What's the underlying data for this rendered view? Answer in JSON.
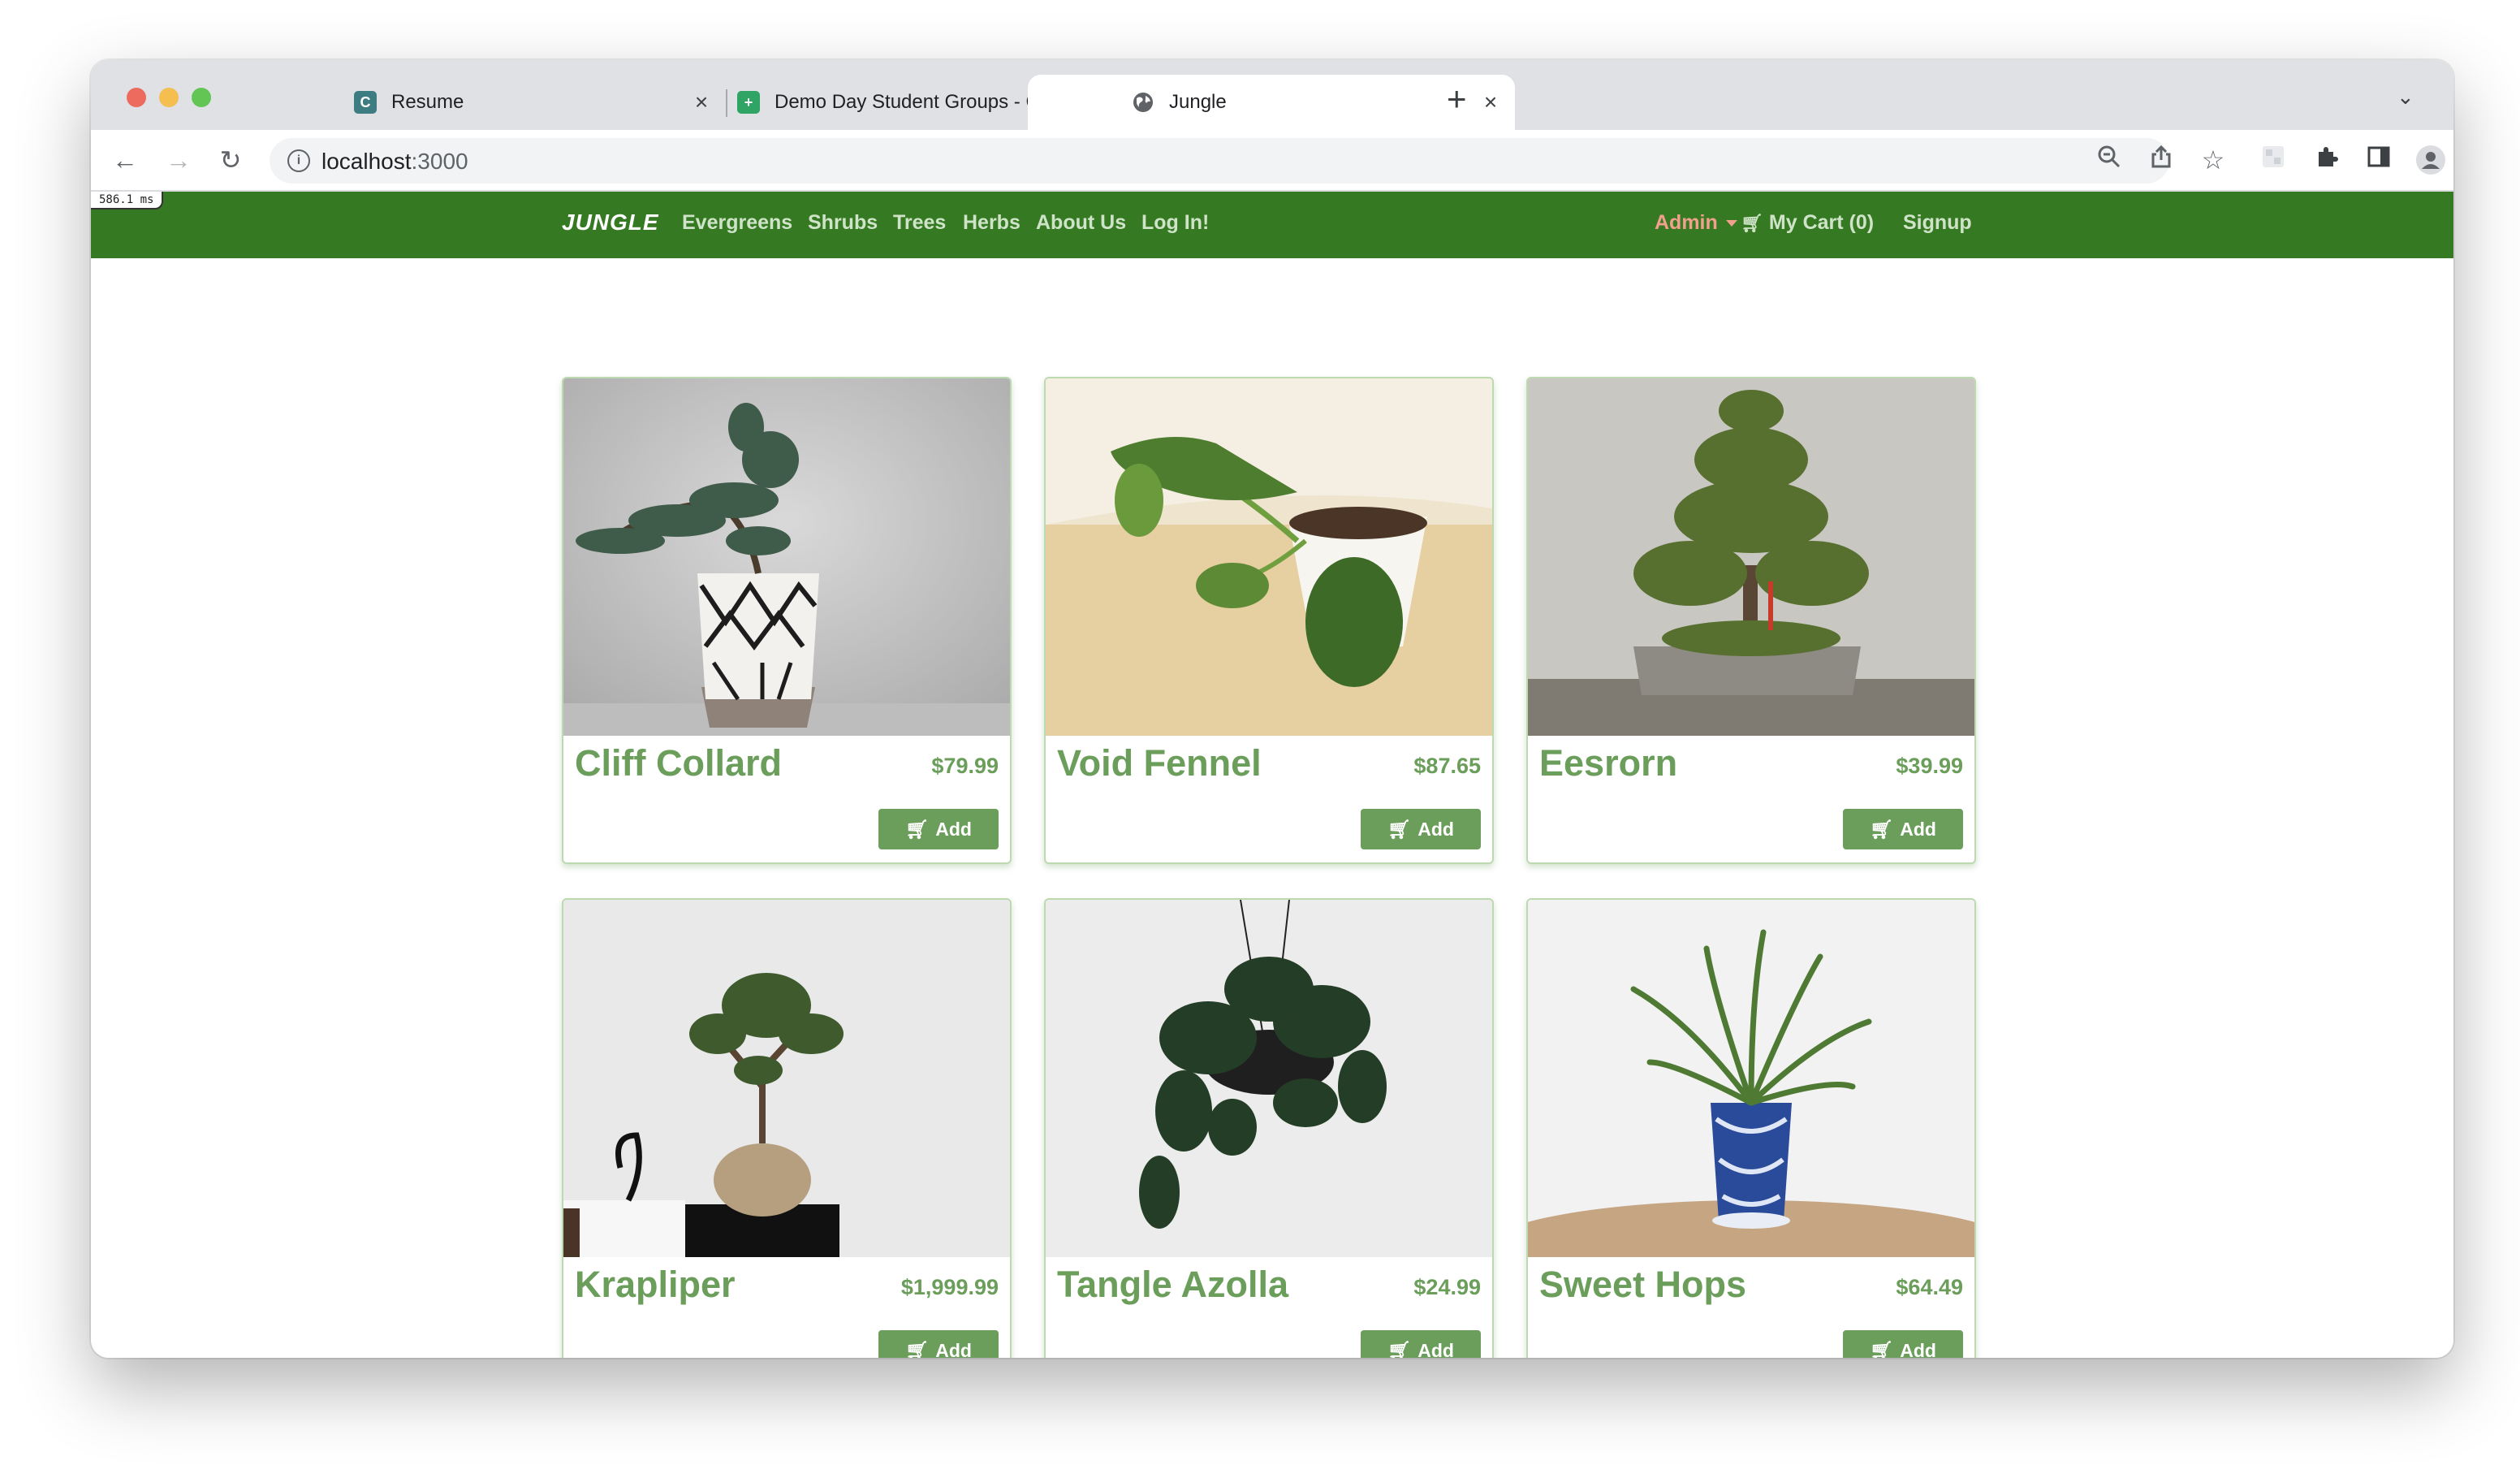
{
  "browser": {
    "tabs": [
      {
        "title": "Resume",
        "favicon": "C",
        "favicon_color": "#3d7d82"
      },
      {
        "title": "Demo Day Student Groups - G",
        "favicon": "+",
        "favicon_color": "#2fa464"
      },
      {
        "title": "Jungle",
        "favicon": "globe-icon",
        "active": true
      }
    ],
    "new_tab": "+",
    "url": {
      "host": "localhost",
      "port": ":3000"
    }
  },
  "timing_badge": "586.1 ms",
  "nav": {
    "brand": "JUNGLE",
    "links": [
      "Evergreens",
      "Shrubs",
      "Trees",
      "Herbs",
      "About Us",
      "Log In!"
    ],
    "admin": "Admin",
    "cart": "My Cart (0)",
    "signup": "Signup",
    "bar_color": "#357a22"
  },
  "products": [
    {
      "name": "Cliff Collard",
      "price": "$79.99",
      "add_label": "Add",
      "image": "juniper-bonsai-in-patterned-pot"
    },
    {
      "name": "Void Fennel",
      "price": "$87.65",
      "add_label": "Add",
      "image": "pothos-cutting-in-white-cup"
    },
    {
      "name": "Eesrorn",
      "price": "$39.99",
      "add_label": "Add",
      "image": "bonsai-tree-in-tray"
    },
    {
      "name": "Krapliper",
      "price": "$1,999.99",
      "add_label": "Add",
      "image": "ficus-bonsai-black-pot"
    },
    {
      "name": "Tangle Azolla",
      "price": "$24.99",
      "add_label": "Add",
      "image": "hanging-philodendron"
    },
    {
      "name": "Sweet Hops",
      "price": "$64.49",
      "add_label": "Add",
      "image": "palm-in-blue-ceramic-pot"
    }
  ],
  "colors": {
    "accent_green": "#6a9e5a",
    "admin_salmon": "#f0a08c"
  }
}
